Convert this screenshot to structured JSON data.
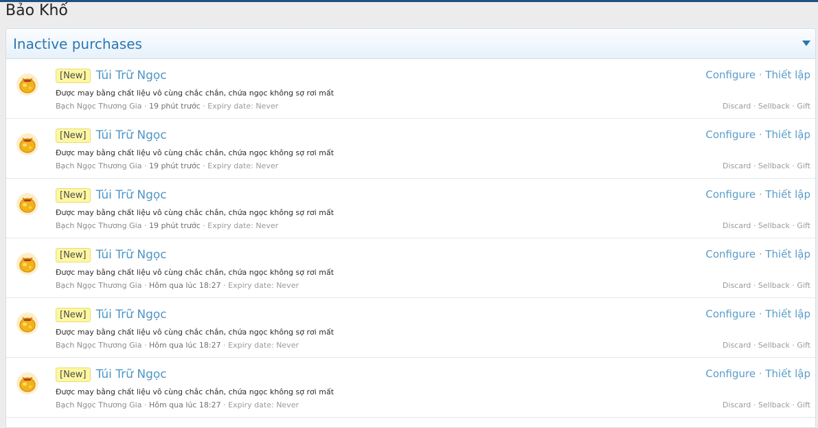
{
  "page": {
    "title": "Bảo Khố"
  },
  "panel": {
    "title": "Inactive purchases"
  },
  "common": {
    "badge": "[New]",
    "separator": "·",
    "configure": "Configure",
    "setup": "Thiết lập",
    "discard": "Discard",
    "sellback": "Sellback",
    "gift": "Gift",
    "expiry_label": "Expiry date:"
  },
  "items": [
    {
      "name": "Túi Trữ Ngọc",
      "desc": "Được may bằng chất liệu vô cùng chắc chắn, chứa ngọc không sợ rơi mất",
      "seller": "Bạch Ngọc Thương Gia",
      "time": "19 phút trước",
      "expiry": "Never"
    },
    {
      "name": "Túi Trữ Ngọc",
      "desc": "Được may bằng chất liệu vô cùng chắc chắn, chứa ngọc không sợ rơi mất",
      "seller": "Bạch Ngọc Thương Gia",
      "time": "19 phút trước",
      "expiry": "Never"
    },
    {
      "name": "Túi Trữ Ngọc",
      "desc": "Được may bằng chất liệu vô cùng chắc chắn, chứa ngọc không sợ rơi mất",
      "seller": "Bạch Ngọc Thương Gia",
      "time": "19 phút trước",
      "expiry": "Never"
    },
    {
      "name": "Túi Trữ Ngọc",
      "desc": "Được may bằng chất liệu vô cùng chắc chắn, chứa ngọc không sợ rơi mất",
      "seller": "Bạch Ngọc Thương Gia",
      "time": "Hôm qua lúc 18:27",
      "expiry": "Never"
    },
    {
      "name": "Túi Trữ Ngọc",
      "desc": "Được may bằng chất liệu vô cùng chắc chắn, chứa ngọc không sợ rơi mất",
      "seller": "Bạch Ngọc Thương Gia",
      "time": "Hôm qua lúc 18:27",
      "expiry": "Never"
    },
    {
      "name": "Túi Trữ Ngọc",
      "desc": "Được may bằng chất liệu vô cùng chắc chắn, chứa ngọc không sợ rơi mất",
      "seller": "Bạch Ngọc Thương Gia",
      "time": "Hôm qua lúc 18:27",
      "expiry": "Never"
    }
  ],
  "icons": {
    "item_icon": "gold-pouch-icon",
    "collapse": "triangle-down-icon"
  },
  "colors": {
    "link": "#4d95c7",
    "panel_title": "#2b76b3",
    "badge_bg": "#fff7a1"
  }
}
